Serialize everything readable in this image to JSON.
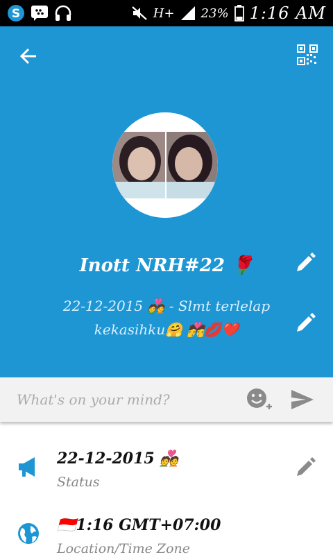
{
  "status_bar": {
    "battery": "23%",
    "time": "1:16 AM",
    "network": "H+"
  },
  "profile": {
    "name": "Inott NRH#22 🌹",
    "status_message": "22-12-2015 💑 - Slmt terlelap kekasihku🤗 💏💋❤️"
  },
  "composer": {
    "placeholder": "What's on your mind?"
  },
  "info": {
    "status": {
      "value": "22-12-2015 💑",
      "label": "Status"
    },
    "location": {
      "value": "1:16 GMT+07:00",
      "label": "Location/Time Zone",
      "flag": "🇮🇩"
    }
  },
  "colors": {
    "header_blue": "#1e96d4",
    "icon_blue": "#1e96d4"
  }
}
